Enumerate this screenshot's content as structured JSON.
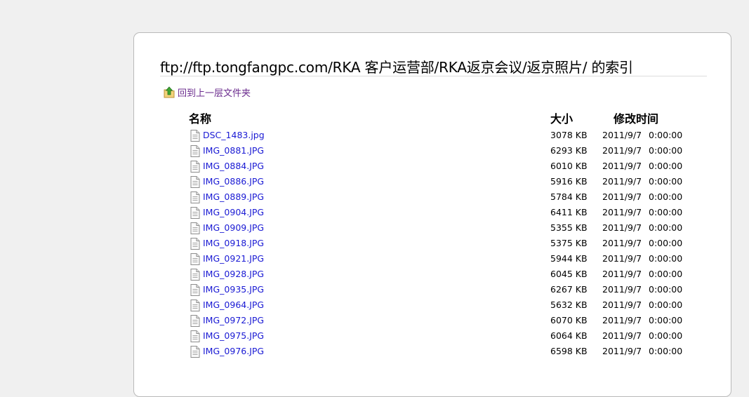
{
  "page": {
    "title": "ftp://ftp.tongfangpc.com/RKA 客户运营部/RKA返京会议/返京照片/ 的索引",
    "up_link_label": "回到上一层文件夹",
    "up_icon": "folder-up-icon",
    "file_icon": "document-icon"
  },
  "columns": {
    "name": "名称",
    "size": "大小",
    "modified": "修改时间"
  },
  "colors": {
    "link": "#1a1ad4",
    "visited_link": "#6b2c8e",
    "background": "#f0f0f0",
    "card": "#ffffff"
  },
  "files": [
    {
      "name": "DSC_1483.jpg",
      "size": "3078 KB",
      "date": "2011/9/7",
      "time": "0:00:00"
    },
    {
      "name": "IMG_0881.JPG",
      "size": "6293 KB",
      "date": "2011/9/7",
      "time": "0:00:00"
    },
    {
      "name": "IMG_0884.JPG",
      "size": "6010 KB",
      "date": "2011/9/7",
      "time": "0:00:00"
    },
    {
      "name": "IMG_0886.JPG",
      "size": "5916 KB",
      "date": "2011/9/7",
      "time": "0:00:00"
    },
    {
      "name": "IMG_0889.JPG",
      "size": "5784 KB",
      "date": "2011/9/7",
      "time": "0:00:00"
    },
    {
      "name": "IMG_0904.JPG",
      "size": "6411 KB",
      "date": "2011/9/7",
      "time": "0:00:00"
    },
    {
      "name": "IMG_0909.JPG",
      "size": "5355 KB",
      "date": "2011/9/7",
      "time": "0:00:00"
    },
    {
      "name": "IMG_0918.JPG",
      "size": "5375 KB",
      "date": "2011/9/7",
      "time": "0:00:00"
    },
    {
      "name": "IMG_0921.JPG",
      "size": "5944 KB",
      "date": "2011/9/7",
      "time": "0:00:00"
    },
    {
      "name": "IMG_0928.JPG",
      "size": "6045 KB",
      "date": "2011/9/7",
      "time": "0:00:00"
    },
    {
      "name": "IMG_0935.JPG",
      "size": "6267 KB",
      "date": "2011/9/7",
      "time": "0:00:00"
    },
    {
      "name": "IMG_0964.JPG",
      "size": "5632 KB",
      "date": "2011/9/7",
      "time": "0:00:00"
    },
    {
      "name": "IMG_0972.JPG",
      "size": "6070 KB",
      "date": "2011/9/7",
      "time": "0:00:00"
    },
    {
      "name": "IMG_0975.JPG",
      "size": "6064 KB",
      "date": "2011/9/7",
      "time": "0:00:00"
    },
    {
      "name": "IMG_0976.JPG",
      "size": "6598 KB",
      "date": "2011/9/7",
      "time": "0:00:00"
    }
  ]
}
